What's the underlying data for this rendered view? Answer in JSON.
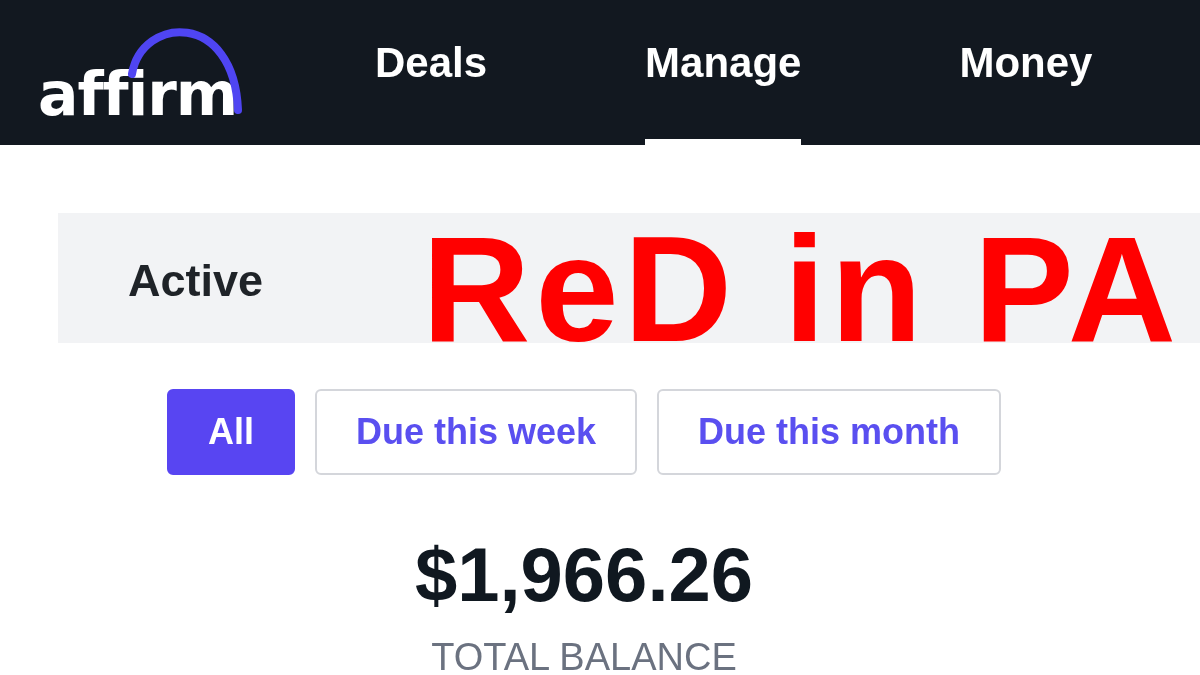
{
  "logo": {
    "text": "affirm"
  },
  "nav_tabs": [
    {
      "label": "Deals",
      "selected": false
    },
    {
      "label": "Manage",
      "selected": true
    },
    {
      "label": "Money",
      "selected": false
    }
  ],
  "section_header": {
    "title": "Active"
  },
  "annotation": {
    "text": "ReD in PA"
  },
  "filters": [
    {
      "label": "All",
      "selected": true
    },
    {
      "label": "Due this week",
      "selected": false
    },
    {
      "label": "Due this month",
      "selected": false
    }
  ],
  "balance": {
    "amount": "$1,966.26",
    "label": "TOTAL BALANCE"
  }
}
